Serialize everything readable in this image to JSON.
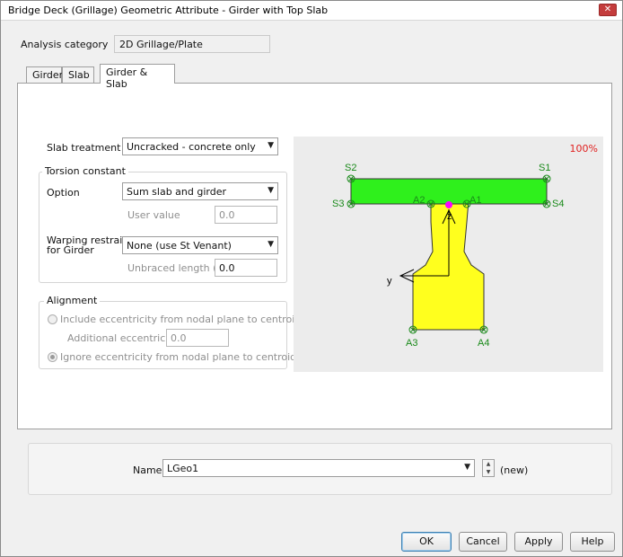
{
  "window": {
    "title": "Bridge Deck (Grillage) Geometric Attribute - Girder with Top Slab",
    "close_glyph": "✕"
  },
  "analysis_category": {
    "label": "Analysis category",
    "value": "2D Grillage/Plate"
  },
  "tabs": [
    {
      "label": "Girder"
    },
    {
      "label": "Slab"
    },
    {
      "label": "Girder & Slab"
    }
  ],
  "slab_treatment": {
    "label": "Slab treatment",
    "value": "Uncracked - concrete only"
  },
  "torsion": {
    "group_label": "Torsion constant",
    "option_label": "Option",
    "option_value": "Sum slab and girder",
    "user_value_label": "User value",
    "user_value": "0.0",
    "warping_label_line1": "Warping restraint",
    "warping_label_line2": "for Girder",
    "warping_value": "None (use St Venant)",
    "unbraced_label": "Unbraced length (Lb)",
    "unbraced_value": "0.0"
  },
  "alignment": {
    "group_label": "Alignment",
    "include_label": "Include eccentricity from nodal plane to centroid",
    "additional_label": "Additional eccentricity",
    "additional_value": "0.0",
    "ignore_label": "Ignore eccentricity from nodal plane to centroid"
  },
  "preview": {
    "zoom": "100%",
    "points": {
      "s1": "S1",
      "s2": "S2",
      "s3": "S3",
      "s4": "S4",
      "a1": "A1",
      "a2": "A2",
      "a3": "A3",
      "a4": "A4"
    },
    "axis_y": "y",
    "axis_z": "z",
    "colors": {
      "slab": "#2ff01c",
      "girder": "#ffff1e",
      "points": "#1a8a1a",
      "centroid": "#ff00ff",
      "zoom": "#e0201f"
    }
  },
  "name_row": {
    "label": "Name",
    "value": "LGeo1",
    "status": "(new)"
  },
  "buttons": {
    "ok": "OK",
    "cancel": "Cancel",
    "apply": "Apply",
    "help": "Help"
  }
}
